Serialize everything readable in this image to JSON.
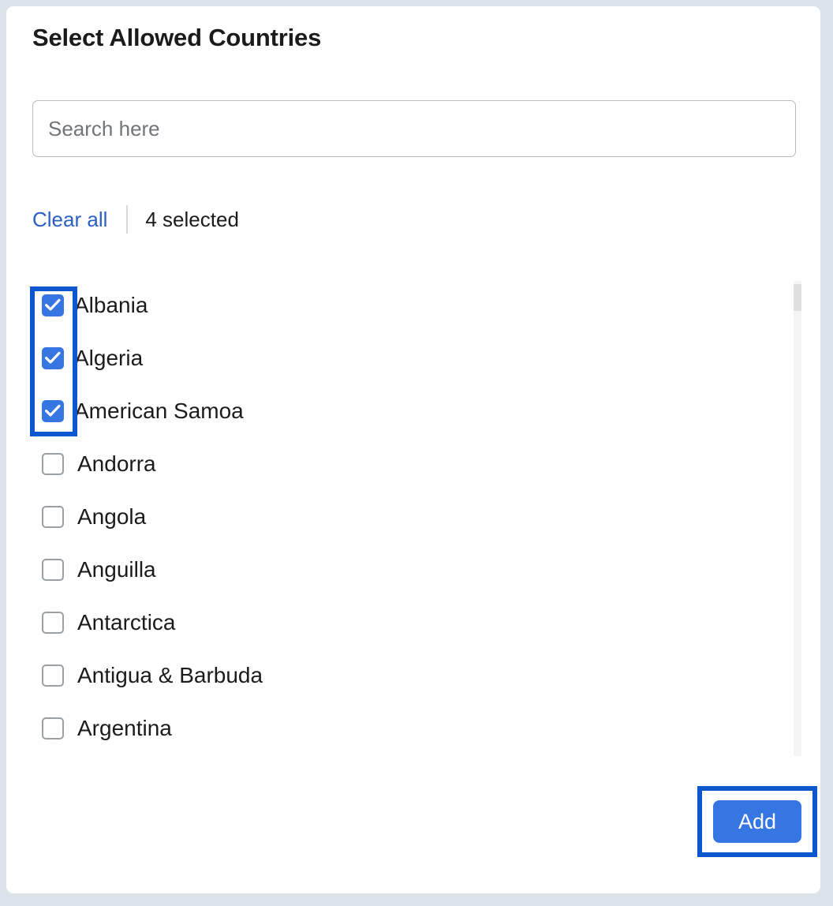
{
  "dialog": {
    "title": "Select Allowed Countries"
  },
  "search": {
    "placeholder": "Search here",
    "value": ""
  },
  "actions": {
    "clear_all_label": "Clear all",
    "selected_count_label": "4 selected"
  },
  "list": {
    "items": [
      {
        "label": "Albania",
        "checked": true
      },
      {
        "label": "Algeria",
        "checked": true
      },
      {
        "label": "American Samoa",
        "checked": true
      },
      {
        "label": "Andorra",
        "checked": false
      },
      {
        "label": "Angola",
        "checked": false
      },
      {
        "label": "Anguilla",
        "checked": false
      },
      {
        "label": "Antarctica",
        "checked": false
      },
      {
        "label": "Antigua & Barbuda",
        "checked": false
      },
      {
        "label": "Argentina",
        "checked": false
      }
    ]
  },
  "footer": {
    "add_label": "Add"
  },
  "icons": {
    "checkmark": "check-icon"
  },
  "colors": {
    "accent_blue": "#3576e3",
    "link_blue": "#2c5fc4",
    "highlight_blue": "#0b57d0",
    "page_background": "#dce3e9",
    "card_background": "#ffffff",
    "text_primary": "#1b1b1b",
    "placeholder_gray": "#70757a",
    "checkbox_border_gray": "#9aa0a6",
    "scrollbar_track": "#f5f5f5",
    "scrollbar_thumb": "#dfdfdf"
  }
}
